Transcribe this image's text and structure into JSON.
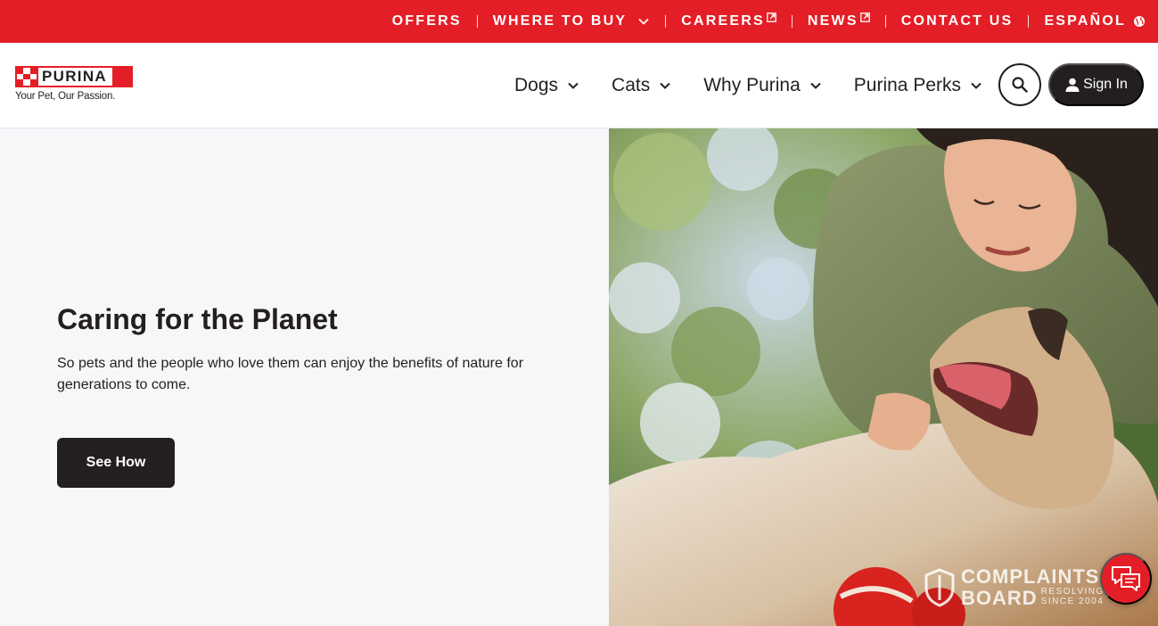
{
  "topbar": {
    "items": [
      {
        "label": "OFFERS"
      },
      {
        "label": "WHERE TO BUY"
      },
      {
        "label": "CAREERS"
      },
      {
        "label": "NEWS"
      },
      {
        "label": "CONTACT US"
      },
      {
        "label": "ESPAÑOL"
      }
    ]
  },
  "brand": {
    "logo_text": "PURINA",
    "tagline": "Your Pet, Our Passion."
  },
  "mainnav": {
    "items": [
      {
        "label": "Dogs"
      },
      {
        "label": "Cats"
      },
      {
        "label": "Why Purina"
      },
      {
        "label": "Purina Perks"
      }
    ],
    "signin_label": "Sign In"
  },
  "hero": {
    "title": "Caring for the Planet",
    "text": "So pets and the people who love them can enjoy the benefits of nature for generations to come.",
    "button_label": "See How"
  },
  "watermark": {
    "line1": "COMPLAINTS",
    "line2": "BOARD",
    "line3a": "RESOLVING",
    "line3b": "SINCE 2004"
  },
  "colors": {
    "brand_red": "#e41e26",
    "dark": "#231f20",
    "hero_bg": "#f7f6f9"
  },
  "icons": {
    "where_to_buy": "chevron-down-icon",
    "careers": "external-link-icon",
    "news": "external-link-icon",
    "espanol": "globe-icon",
    "search": "search-icon",
    "signin": "user-icon",
    "chat": "chat-icon"
  }
}
